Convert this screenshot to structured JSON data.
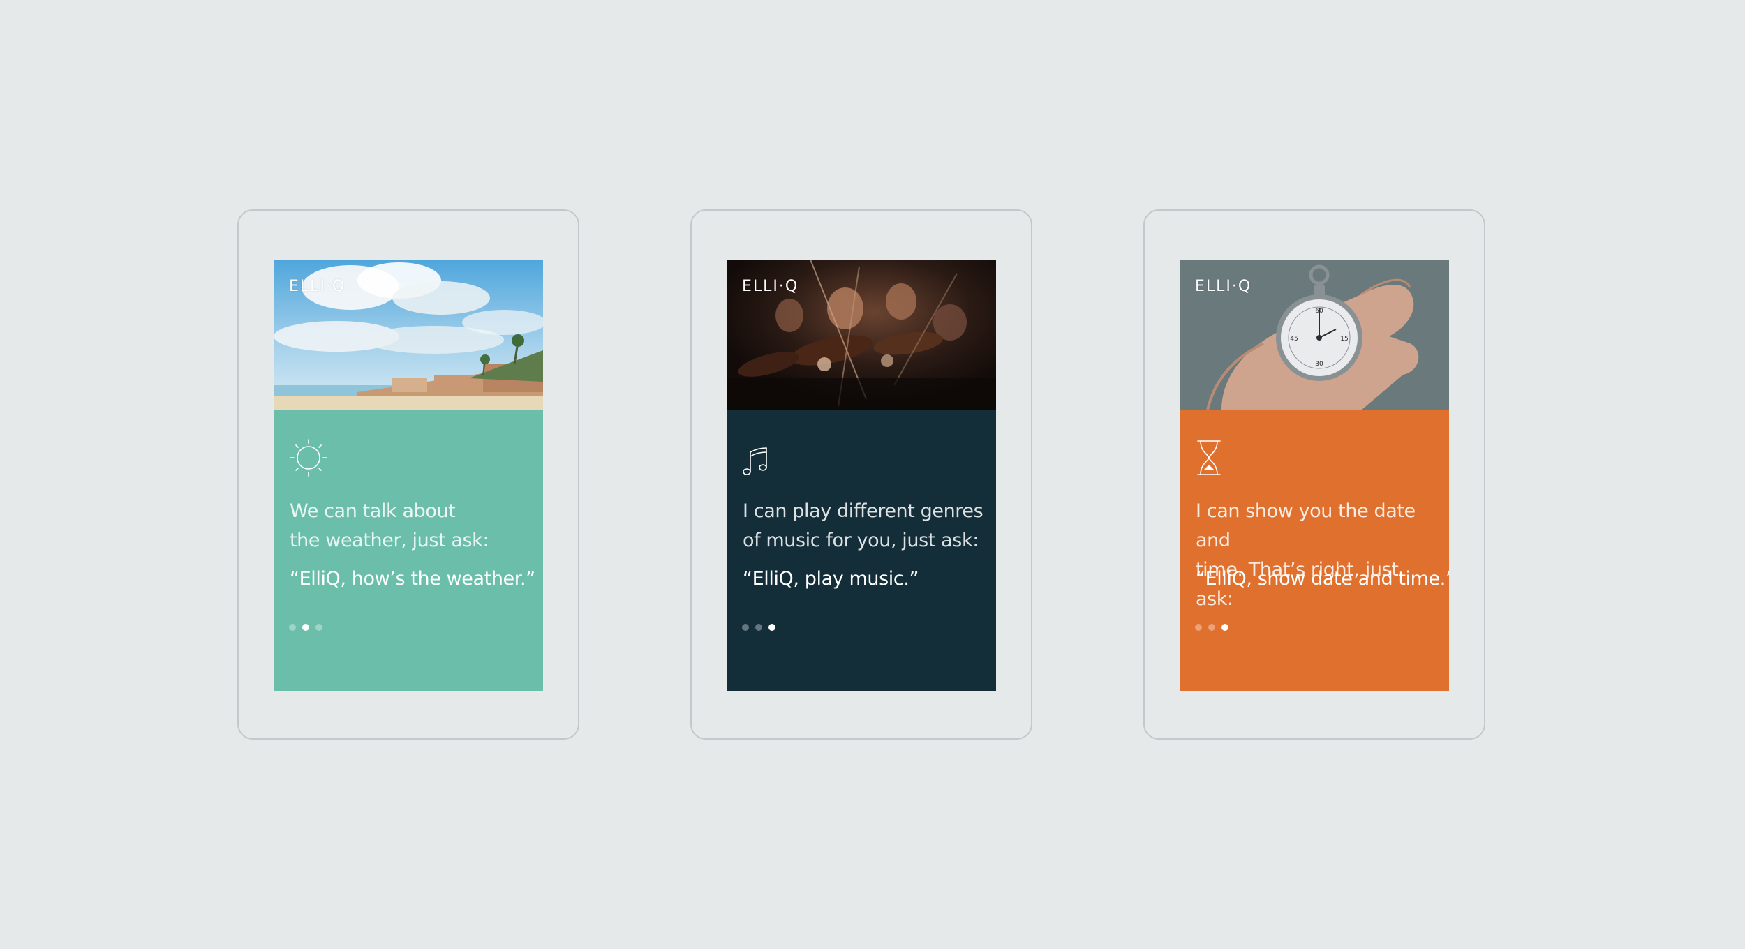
{
  "cards": [
    {
      "logo": "ELLI·Q",
      "photo": "beach-weather-photo",
      "icon": "sun-icon",
      "panel_color": "#6bbfaa",
      "description": "We can talk about\nthe weather, just ask:",
      "quote": "“ElliQ, how’s the weather.”",
      "active_dot": 2,
      "dot_count": 3
    },
    {
      "logo": "ELLI·Q",
      "photo": "orchestra-violins-photo",
      "icon": "music-note-icon",
      "panel_color": "#132e39",
      "description": "I can play different genres\nof music for you, just ask:",
      "quote": "“ElliQ, play music.”",
      "active_dot": 3,
      "dot_count": 3
    },
    {
      "logo": "ELLI·Q",
      "photo": "stopwatch-in-hand-photo",
      "icon": "hourglass-icon",
      "panel_color": "#e0702e",
      "description": "I can show you the date and\ntime. That’s right, just ask:",
      "quote": "“ElliQ, show date and time.”",
      "active_dot": 3,
      "dot_count": 3
    }
  ]
}
